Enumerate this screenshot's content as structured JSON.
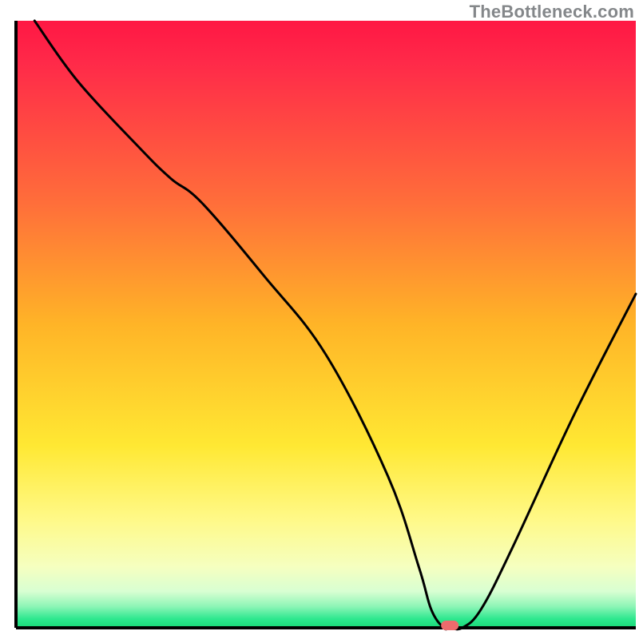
{
  "watermark": "TheBottleneck.com",
  "chart_data": {
    "type": "line",
    "title": "",
    "xlabel": "",
    "ylabel": "",
    "xlim": [
      0,
      100
    ],
    "ylim": [
      0,
      100
    ],
    "x": [
      3,
      10,
      20,
      25,
      30,
      40,
      50,
      60,
      65,
      67,
      69,
      70,
      72,
      75,
      80,
      90,
      100
    ],
    "values": [
      100,
      90,
      79,
      74,
      70,
      58,
      45,
      25,
      10,
      3,
      0,
      0,
      0,
      3,
      13,
      35,
      55
    ],
    "marker": {
      "x": 70,
      "y": 0
    },
    "gradient_stops": [
      {
        "offset": 0.0,
        "color": "#ff1744"
      },
      {
        "offset": 0.07,
        "color": "#ff2a49"
      },
      {
        "offset": 0.3,
        "color": "#ff6e3a"
      },
      {
        "offset": 0.5,
        "color": "#ffb427"
      },
      {
        "offset": 0.7,
        "color": "#ffe833"
      },
      {
        "offset": 0.82,
        "color": "#fff987"
      },
      {
        "offset": 0.9,
        "color": "#f5ffc0"
      },
      {
        "offset": 0.94,
        "color": "#d8ffd2"
      },
      {
        "offset": 0.965,
        "color": "#8cf5b6"
      },
      {
        "offset": 0.985,
        "color": "#2fe88f"
      },
      {
        "offset": 1.0,
        "color": "#18d877"
      }
    ],
    "axis_color": "#000000",
    "line_color": "#000000",
    "marker_color": "#ed6b6d"
  }
}
